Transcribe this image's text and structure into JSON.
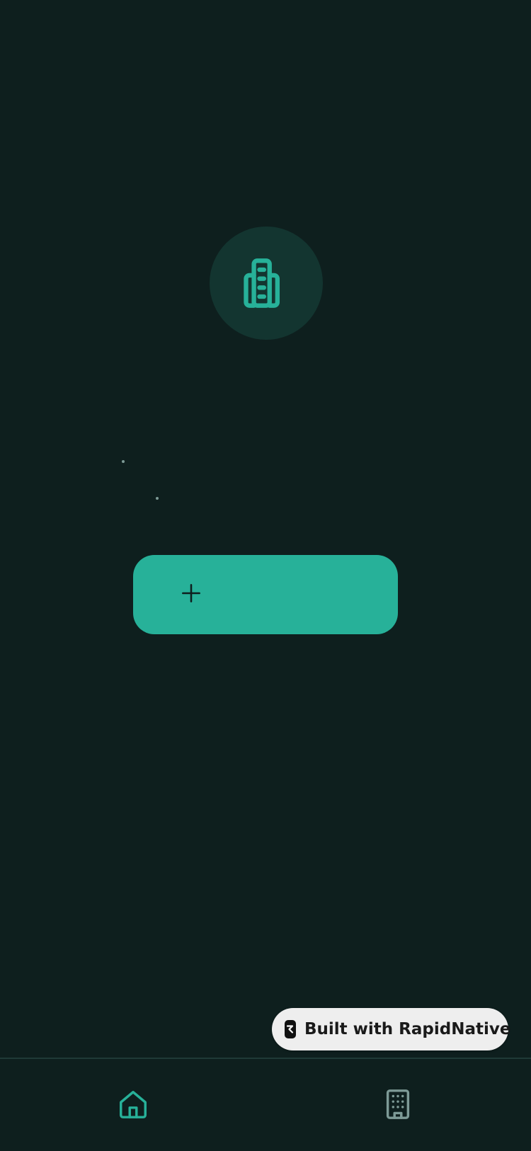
{
  "app": {
    "colors": {
      "background": "#0e1f1e",
      "accent": "#27b199",
      "hero_circle": "#133530",
      "inactive_icon": "#7d9a96",
      "badge_background": "#eeeeee"
    }
  },
  "hero": {
    "icon": "building-icon"
  },
  "primary_action": {
    "icon": "plus-icon",
    "label": ""
  },
  "badge": {
    "text": "Built with RapidNative",
    "icon": "rapidnative-logo-icon"
  },
  "tab_bar": {
    "active_tab": "home",
    "tabs": [
      {
        "id": "home",
        "icon": "home-icon",
        "active": true
      },
      {
        "id": "buildings",
        "icon": "office-building-icon",
        "active": false
      }
    ]
  }
}
